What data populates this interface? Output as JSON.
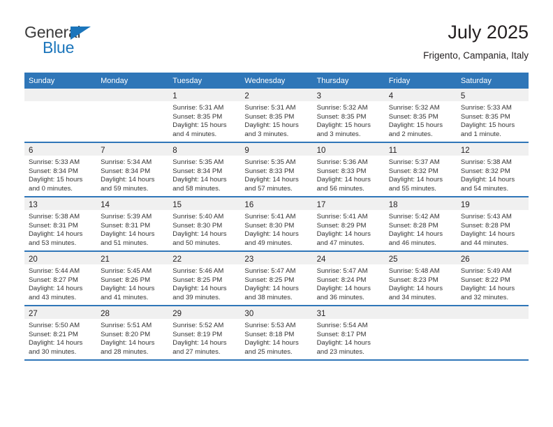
{
  "brand": {
    "name_part1": "General",
    "name_part2": "Blue"
  },
  "header": {
    "title": "July 2025",
    "subtitle": "Frigento, Campania, Italy"
  },
  "calendar": {
    "weekday_headers": [
      "Sunday",
      "Monday",
      "Tuesday",
      "Wednesday",
      "Thursday",
      "Friday",
      "Saturday"
    ],
    "accent_color": "#2f76b8",
    "daynum_band_color": "#f0f0f0",
    "weeks": [
      [
        {
          "day": "",
          "empty": true
        },
        {
          "day": "",
          "empty": true
        },
        {
          "day": "1",
          "sunrise": "Sunrise: 5:31 AM",
          "sunset": "Sunset: 8:35 PM",
          "daylight_l1": "Daylight: 15 hours",
          "daylight_l2": "and 4 minutes."
        },
        {
          "day": "2",
          "sunrise": "Sunrise: 5:31 AM",
          "sunset": "Sunset: 8:35 PM",
          "daylight_l1": "Daylight: 15 hours",
          "daylight_l2": "and 3 minutes."
        },
        {
          "day": "3",
          "sunrise": "Sunrise: 5:32 AM",
          "sunset": "Sunset: 8:35 PM",
          "daylight_l1": "Daylight: 15 hours",
          "daylight_l2": "and 3 minutes."
        },
        {
          "day": "4",
          "sunrise": "Sunrise: 5:32 AM",
          "sunset": "Sunset: 8:35 PM",
          "daylight_l1": "Daylight: 15 hours",
          "daylight_l2": "and 2 minutes."
        },
        {
          "day": "5",
          "sunrise": "Sunrise: 5:33 AM",
          "sunset": "Sunset: 8:35 PM",
          "daylight_l1": "Daylight: 15 hours",
          "daylight_l2": "and 1 minute."
        }
      ],
      [
        {
          "day": "6",
          "sunrise": "Sunrise: 5:33 AM",
          "sunset": "Sunset: 8:34 PM",
          "daylight_l1": "Daylight: 15 hours",
          "daylight_l2": "and 0 minutes."
        },
        {
          "day": "7",
          "sunrise": "Sunrise: 5:34 AM",
          "sunset": "Sunset: 8:34 PM",
          "daylight_l1": "Daylight: 14 hours",
          "daylight_l2": "and 59 minutes."
        },
        {
          "day": "8",
          "sunrise": "Sunrise: 5:35 AM",
          "sunset": "Sunset: 8:34 PM",
          "daylight_l1": "Daylight: 14 hours",
          "daylight_l2": "and 58 minutes."
        },
        {
          "day": "9",
          "sunrise": "Sunrise: 5:35 AM",
          "sunset": "Sunset: 8:33 PM",
          "daylight_l1": "Daylight: 14 hours",
          "daylight_l2": "and 57 minutes."
        },
        {
          "day": "10",
          "sunrise": "Sunrise: 5:36 AM",
          "sunset": "Sunset: 8:33 PM",
          "daylight_l1": "Daylight: 14 hours",
          "daylight_l2": "and 56 minutes."
        },
        {
          "day": "11",
          "sunrise": "Sunrise: 5:37 AM",
          "sunset": "Sunset: 8:32 PM",
          "daylight_l1": "Daylight: 14 hours",
          "daylight_l2": "and 55 minutes."
        },
        {
          "day": "12",
          "sunrise": "Sunrise: 5:38 AM",
          "sunset": "Sunset: 8:32 PM",
          "daylight_l1": "Daylight: 14 hours",
          "daylight_l2": "and 54 minutes."
        }
      ],
      [
        {
          "day": "13",
          "sunrise": "Sunrise: 5:38 AM",
          "sunset": "Sunset: 8:31 PM",
          "daylight_l1": "Daylight: 14 hours",
          "daylight_l2": "and 53 minutes."
        },
        {
          "day": "14",
          "sunrise": "Sunrise: 5:39 AM",
          "sunset": "Sunset: 8:31 PM",
          "daylight_l1": "Daylight: 14 hours",
          "daylight_l2": "and 51 minutes."
        },
        {
          "day": "15",
          "sunrise": "Sunrise: 5:40 AM",
          "sunset": "Sunset: 8:30 PM",
          "daylight_l1": "Daylight: 14 hours",
          "daylight_l2": "and 50 minutes."
        },
        {
          "day": "16",
          "sunrise": "Sunrise: 5:41 AM",
          "sunset": "Sunset: 8:30 PM",
          "daylight_l1": "Daylight: 14 hours",
          "daylight_l2": "and 49 minutes."
        },
        {
          "day": "17",
          "sunrise": "Sunrise: 5:41 AM",
          "sunset": "Sunset: 8:29 PM",
          "daylight_l1": "Daylight: 14 hours",
          "daylight_l2": "and 47 minutes."
        },
        {
          "day": "18",
          "sunrise": "Sunrise: 5:42 AM",
          "sunset": "Sunset: 8:28 PM",
          "daylight_l1": "Daylight: 14 hours",
          "daylight_l2": "and 46 minutes."
        },
        {
          "day": "19",
          "sunrise": "Sunrise: 5:43 AM",
          "sunset": "Sunset: 8:28 PM",
          "daylight_l1": "Daylight: 14 hours",
          "daylight_l2": "and 44 minutes."
        }
      ],
      [
        {
          "day": "20",
          "sunrise": "Sunrise: 5:44 AM",
          "sunset": "Sunset: 8:27 PM",
          "daylight_l1": "Daylight: 14 hours",
          "daylight_l2": "and 43 minutes."
        },
        {
          "day": "21",
          "sunrise": "Sunrise: 5:45 AM",
          "sunset": "Sunset: 8:26 PM",
          "daylight_l1": "Daylight: 14 hours",
          "daylight_l2": "and 41 minutes."
        },
        {
          "day": "22",
          "sunrise": "Sunrise: 5:46 AM",
          "sunset": "Sunset: 8:25 PM",
          "daylight_l1": "Daylight: 14 hours",
          "daylight_l2": "and 39 minutes."
        },
        {
          "day": "23",
          "sunrise": "Sunrise: 5:47 AM",
          "sunset": "Sunset: 8:25 PM",
          "daylight_l1": "Daylight: 14 hours",
          "daylight_l2": "and 38 minutes."
        },
        {
          "day": "24",
          "sunrise": "Sunrise: 5:47 AM",
          "sunset": "Sunset: 8:24 PM",
          "daylight_l1": "Daylight: 14 hours",
          "daylight_l2": "and 36 minutes."
        },
        {
          "day": "25",
          "sunrise": "Sunrise: 5:48 AM",
          "sunset": "Sunset: 8:23 PM",
          "daylight_l1": "Daylight: 14 hours",
          "daylight_l2": "and 34 minutes."
        },
        {
          "day": "26",
          "sunrise": "Sunrise: 5:49 AM",
          "sunset": "Sunset: 8:22 PM",
          "daylight_l1": "Daylight: 14 hours",
          "daylight_l2": "and 32 minutes."
        }
      ],
      [
        {
          "day": "27",
          "sunrise": "Sunrise: 5:50 AM",
          "sunset": "Sunset: 8:21 PM",
          "daylight_l1": "Daylight: 14 hours",
          "daylight_l2": "and 30 minutes."
        },
        {
          "day": "28",
          "sunrise": "Sunrise: 5:51 AM",
          "sunset": "Sunset: 8:20 PM",
          "daylight_l1": "Daylight: 14 hours",
          "daylight_l2": "and 28 minutes."
        },
        {
          "day": "29",
          "sunrise": "Sunrise: 5:52 AM",
          "sunset": "Sunset: 8:19 PM",
          "daylight_l1": "Daylight: 14 hours",
          "daylight_l2": "and 27 minutes."
        },
        {
          "day": "30",
          "sunrise": "Sunrise: 5:53 AM",
          "sunset": "Sunset: 8:18 PM",
          "daylight_l1": "Daylight: 14 hours",
          "daylight_l2": "and 25 minutes."
        },
        {
          "day": "31",
          "sunrise": "Sunrise: 5:54 AM",
          "sunset": "Sunset: 8:17 PM",
          "daylight_l1": "Daylight: 14 hours",
          "daylight_l2": "and 23 minutes."
        },
        {
          "day": "",
          "empty": true
        },
        {
          "day": "",
          "empty": true
        }
      ]
    ]
  }
}
